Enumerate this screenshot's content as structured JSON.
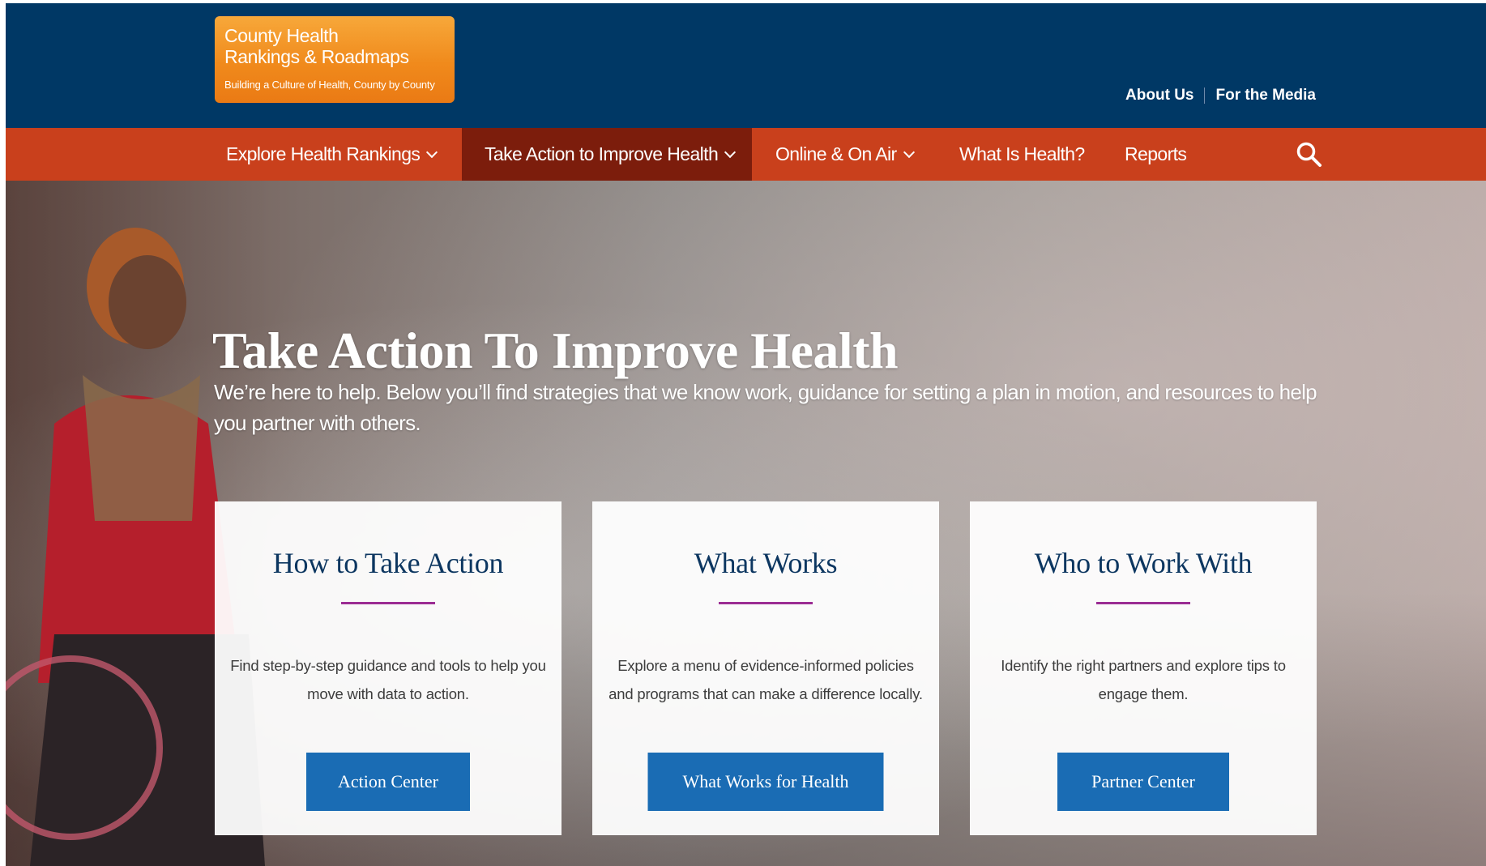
{
  "logo": {
    "line1": "County Health",
    "line2": "Rankings & Roadmaps",
    "tagline": "Building a Culture of Health, County by County"
  },
  "utility_nav": [
    "About Us",
    "For the Media"
  ],
  "main_nav": [
    {
      "label": "Explore Health Rankings",
      "has_dropdown": true,
      "active": false
    },
    {
      "label": "Take Action to Improve Health",
      "has_dropdown": true,
      "active": true
    },
    {
      "label": "Online & On Air",
      "has_dropdown": true,
      "active": false
    },
    {
      "label": "What Is Health?",
      "has_dropdown": false,
      "active": false
    },
    {
      "label": "Reports",
      "has_dropdown": false,
      "active": false
    }
  ],
  "search_icon": "search-icon",
  "hero": {
    "title": "Take Action To Improve Health",
    "subtitle": "We’re here to help. Below you’ll find strategies that we know work, guidance for setting a plan in motion, and resources to help you partner with others."
  },
  "cards": [
    {
      "title": "How to Take Action",
      "text": "Find step-by-step guidance and tools to help you move with data to action.",
      "button": "Action Center"
    },
    {
      "title": "What Works",
      "text": "Explore a menu of evidence-informed policies and programs that can make a difference locally.",
      "button": "What Works for Health"
    },
    {
      "title": "Who to Work With",
      "text": "Identify the right partners and explore tips to engage them.",
      "button": "Partner Center"
    }
  ],
  "colors": {
    "topbar": "#003865",
    "nav": "#c9401c",
    "nav_active": "#7c1d0c",
    "button": "#1a6cb4",
    "card_rule": "#9b2c93",
    "card_title": "#0c3660"
  }
}
